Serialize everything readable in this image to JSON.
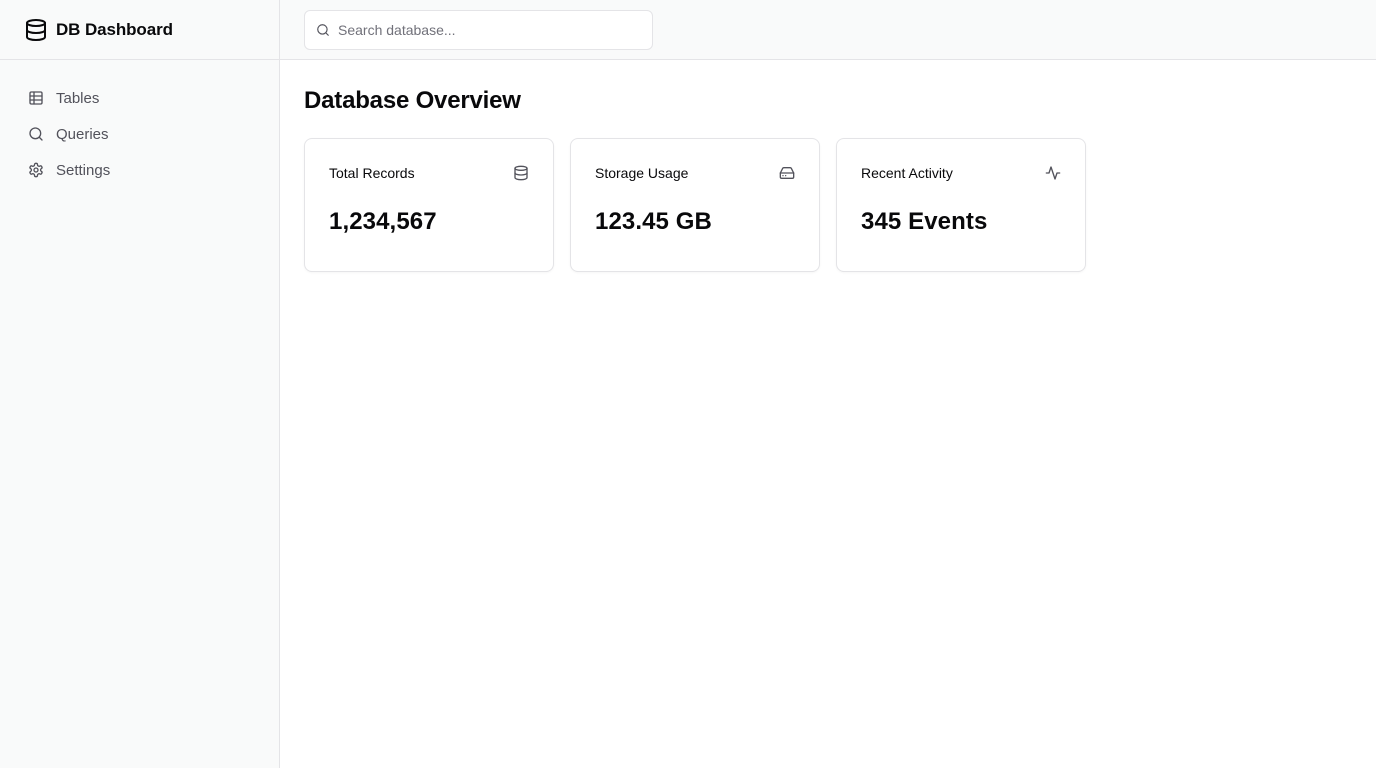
{
  "brand": {
    "title": "DB Dashboard",
    "icon": "database-icon"
  },
  "sidebar": {
    "items": [
      {
        "label": "Tables",
        "icon": "table-icon"
      },
      {
        "label": "Queries",
        "icon": "search-icon"
      },
      {
        "label": "Settings",
        "icon": "gear-icon"
      }
    ]
  },
  "search": {
    "placeholder": "Search database...",
    "value": ""
  },
  "main": {
    "title": "Database Overview",
    "cards": [
      {
        "label": "Total Records",
        "value": "1,234,567",
        "icon": "database-icon"
      },
      {
        "label": "Storage Usage",
        "value": "123.45 GB",
        "icon": "hard-drive-icon"
      },
      {
        "label": "Recent Activity",
        "value": "345 Events",
        "icon": "activity-icon"
      }
    ]
  },
  "colors": {
    "sidebar_bg": "#f9fafa",
    "border": "#e4e4e7",
    "text": "#09090b",
    "muted": "#71717a",
    "nav_text": "#52525b"
  }
}
